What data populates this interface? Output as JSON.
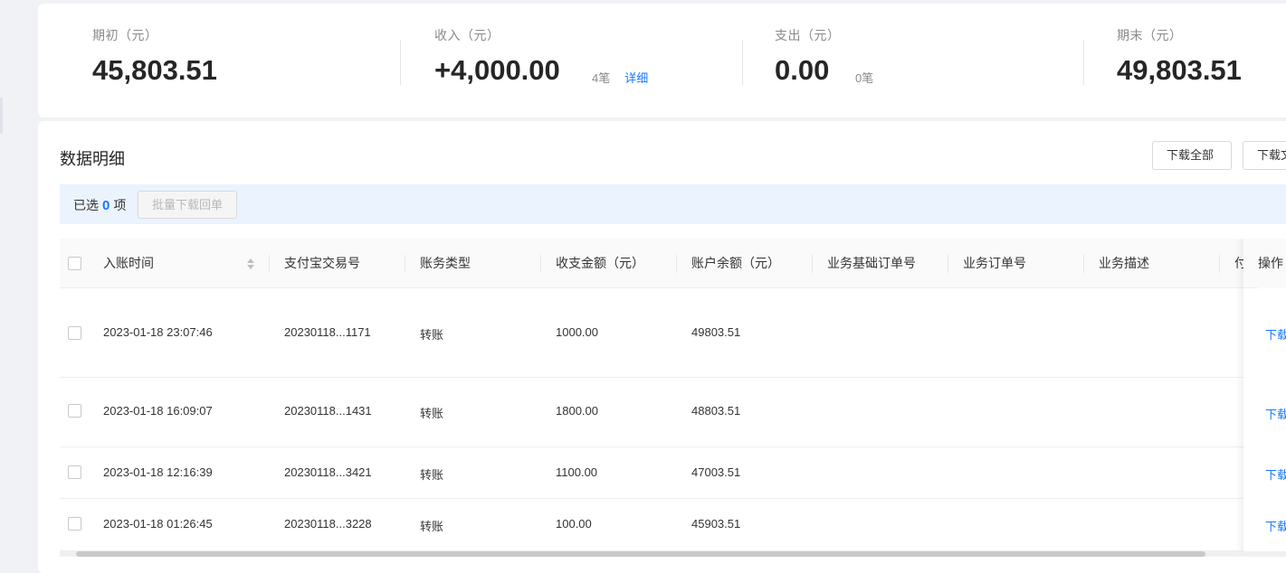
{
  "summary": {
    "opening": {
      "label": "期初（元）",
      "value": "45,803.51"
    },
    "income": {
      "label": "收入（元）",
      "value": "+4,000.00",
      "count": "4笔",
      "detail_link": "详细"
    },
    "expense": {
      "label": "支出（元）",
      "value": "0.00",
      "count": "0笔"
    },
    "closing": {
      "label": "期末（元）",
      "value": "49,803.51"
    }
  },
  "details": {
    "title": "数据明细",
    "download_all": "下载全部",
    "download_other": "下载文件",
    "selection": {
      "prefix": "已选",
      "count": "0",
      "suffix": "项",
      "batch_button": "批量下载回单"
    }
  },
  "table": {
    "columns": [
      "入账时间",
      "支付宝交易号",
      "账务类型",
      "收支金额（元）",
      "账户余额（元）",
      "业务基础订单号",
      "业务订单号",
      "业务描述",
      "付款",
      "操作"
    ],
    "rows": [
      {
        "time": "2023-01-18 23:07:46",
        "trade_no": "20230118...1171",
        "type": "转账",
        "amount": "1000.00",
        "balance": "49803.51",
        "op": "下载"
      },
      {
        "time": "2023-01-18 16:09:07",
        "trade_no": "20230118...1431",
        "type": "转账",
        "amount": "1800.00",
        "balance": "48803.51",
        "op": "下载"
      },
      {
        "time": "2023-01-18 12:16:39",
        "trade_no": "20230118...3421",
        "type": "转账",
        "amount": "1100.00",
        "balance": "47003.51",
        "op": "下载"
      },
      {
        "time": "2023-01-18 01:26:45",
        "trade_no": "20230118...3228",
        "type": "转账",
        "amount": "100.00",
        "balance": "45903.51",
        "op": "下载"
      }
    ]
  },
  "colors": {
    "accent": "#1677ff",
    "selection_bar": "#ebf3fe"
  }
}
